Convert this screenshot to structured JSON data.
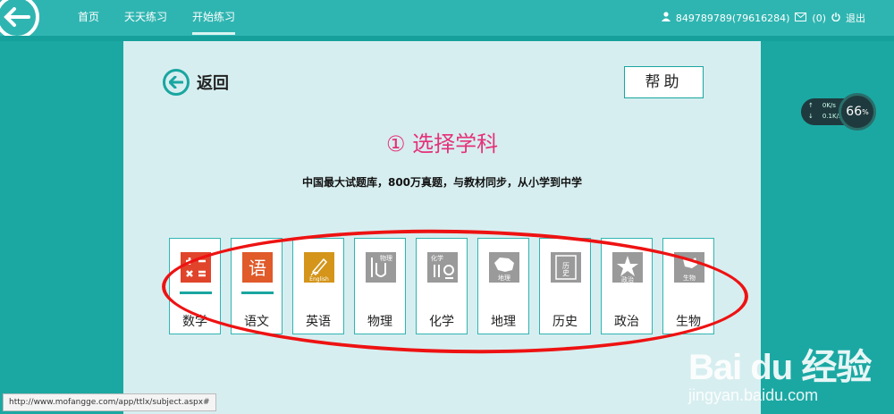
{
  "nav": {
    "items": [
      {
        "label": "首页"
      },
      {
        "label": "天天练习"
      },
      {
        "label": "开始练习"
      }
    ],
    "user": "849789789(79616284)",
    "messages": "(0)",
    "logout": "退出"
  },
  "card": {
    "back_label": "返回",
    "help_label": "帮助",
    "step_title": "① 选择学科",
    "subtitle": "中国最大试题库，800万真题，与教材同步，从小学到中学",
    "subjects": [
      {
        "name": "数学",
        "icon": "math-icon",
        "icon_text": "",
        "color": "#e0442a"
      },
      {
        "name": "语文",
        "icon": "chinese-icon",
        "icon_text": "语",
        "color": "#e05a2a"
      },
      {
        "name": "英语",
        "icon": "english-icon",
        "icon_text": "English",
        "color": "#d4951a"
      },
      {
        "name": "物理",
        "icon": "physics-icon",
        "icon_text": "物理",
        "color": "#9a9a9a"
      },
      {
        "name": "化学",
        "icon": "chemistry-icon",
        "icon_text": "化学",
        "color": "#9a9a9a"
      },
      {
        "name": "地理",
        "icon": "geography-icon",
        "icon_text": "地理",
        "color": "#9a9a9a"
      },
      {
        "name": "历史",
        "icon": "history-icon",
        "icon_text": "历史",
        "color": "#9a9a9a"
      },
      {
        "name": "政治",
        "icon": "politics-icon",
        "icon_text": "政治",
        "color": "#9a9a9a"
      },
      {
        "name": "生物",
        "icon": "biology-icon",
        "icon_text": "生物",
        "color": "#9a9a9a"
      }
    ]
  },
  "speed_widget": {
    "up": "0K/s",
    "down": "0.1K/s",
    "percent": "66",
    "percent_unit": "%"
  },
  "status_url": "http://www.mofangge.com/app/ttlx/subject.aspx#",
  "watermark": {
    "brand": "Bai du 经验",
    "site": "jingyan.baidu.com"
  }
}
